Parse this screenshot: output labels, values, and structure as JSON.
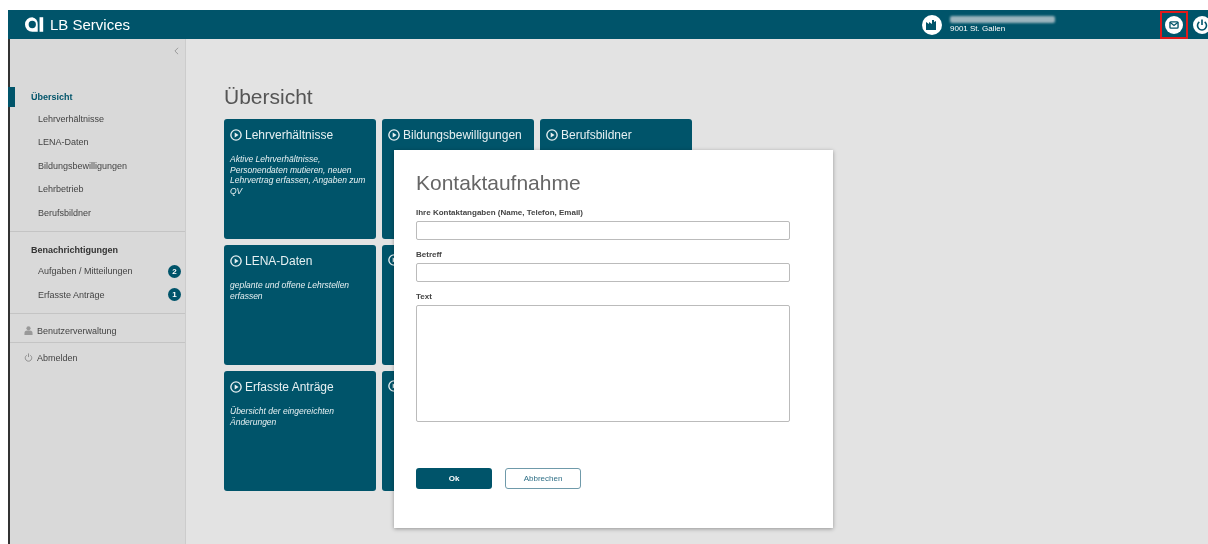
{
  "app": {
    "title": "LB Services"
  },
  "user": {
    "location": "9001 St. Gallen"
  },
  "sidebar": {
    "sections": [
      {
        "heading": "Übersicht",
        "selected": true,
        "items": [
          {
            "label": "Lehrverhältnisse"
          },
          {
            "label": "LENA-Daten"
          },
          {
            "label": "Bildungsbewilligungen"
          },
          {
            "label": "Lehrbetrieb"
          },
          {
            "label": "Berufsbildner"
          }
        ]
      },
      {
        "heading": "Benachrichtigungen",
        "selected": false,
        "items": [
          {
            "label": "Aufgaben / Mitteilungen",
            "badge": "2"
          },
          {
            "label": "Erfasste Anträge",
            "badge": "1"
          }
        ]
      }
    ],
    "links": [
      {
        "label": "Benutzerverwaltung",
        "kind": "user"
      },
      {
        "label": "Abmelden",
        "kind": "power"
      }
    ]
  },
  "page": {
    "title": "Übersicht"
  },
  "tile_rows": [
    [
      {
        "title": "Lehrverhältnisse",
        "description": "Aktive Lehrverhältnisse, Personendaten mutieren, neuen Lehrvertrag erfassen, Angaben zum QV"
      },
      {
        "title": "Bildungsbewilligungen"
      },
      {
        "title": "Berufsbildner"
      }
    ],
    [
      {
        "title": "LENA-Daten",
        "description": "geplante und offene Lehrstellen erfassen"
      },
      {
        "kind": "obscured"
      }
    ],
    [
      {
        "title": "Erfasste Anträge",
        "description": "Übersicht der eingereichten Änderungen"
      },
      {
        "kind": "obscured"
      }
    ]
  ],
  "dialog": {
    "title": "Kontaktaufnahme",
    "fields": [
      {
        "label": "Ihre Kontaktangaben (Name, Telefon, Email)",
        "kind": "input"
      },
      {
        "label": "Betreff",
        "kind": "input"
      },
      {
        "label": "Text",
        "kind": "textarea"
      }
    ],
    "buttons": [
      {
        "label": "Ok",
        "kind": "primary"
      },
      {
        "label": "Abbrechen",
        "kind": "secondary"
      }
    ]
  }
}
